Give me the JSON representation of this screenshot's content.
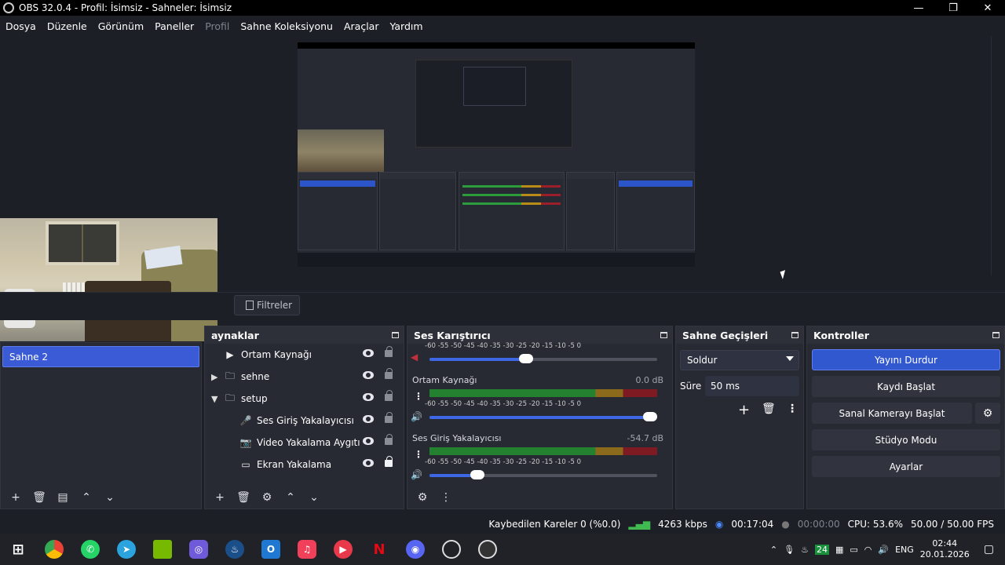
{
  "window": {
    "title": "OBS 32.0.4 - Profil: İsimsiz - Sahneler: İsimsiz",
    "minimize": "—",
    "restore": "❐",
    "close": "✕"
  },
  "menu": [
    "Dosya",
    "Düzenle",
    "Görünüm",
    "Paneller",
    "Profil",
    "Sahne Koleksiyonu",
    "Araçlar",
    "Yardım"
  ],
  "filter_button": "Filtreler",
  "scenes": {
    "title_visible": "",
    "items": [
      "Sahne 2"
    ]
  },
  "sources": {
    "title": "aynaklar",
    "items": [
      {
        "label": "Ortam Kaynağı",
        "icon": "play-icon",
        "indent": 0,
        "expand": "",
        "locked": false
      },
      {
        "label": "sehne",
        "icon": "folder-icon",
        "indent": 0,
        "expand": "▶",
        "locked": false
      },
      {
        "label": "setup",
        "icon": "folder-icon",
        "indent": 0,
        "expand": "▼",
        "locked": false
      },
      {
        "label": "Ses Giriş Yakalayıcısı",
        "icon": "microphone-icon",
        "indent": 1,
        "expand": "",
        "locked": false
      },
      {
        "label": "Video Yakalama Aygıtı",
        "icon": "camera-icon",
        "indent": 1,
        "expand": "",
        "locked": false
      },
      {
        "label": "Ekran Yakalama",
        "icon": "monitor-icon",
        "indent": 1,
        "expand": "",
        "locked": true
      }
    ]
  },
  "mixer": {
    "title": "Ses Karıştırıcı",
    "ticks": "-60  -55  -50  -45  -40  -35  -30  -25  -20  -15  -10  -5  0",
    "channels": [
      {
        "name": "",
        "db": "",
        "volume": 0.4
      },
      {
        "name": "Ortam Kaynağı",
        "db": "0.0 dB",
        "volume": 1.0
      },
      {
        "name": "Ses Giriş Yakalayıcısı",
        "db": "-54.7 dB",
        "volume": 0.2
      }
    ]
  },
  "transitions": {
    "title": "Sahne Geçişleri",
    "selected": "Soldur",
    "duration_label": "Süre",
    "duration_value": "50 ms"
  },
  "controls": {
    "title": "Kontroller",
    "buttons": [
      "Yayını Durdur",
      "Kaydı Başlat",
      "Sanal Kamerayı Başlat",
      "Stüdyo Modu",
      "Ayarlar"
    ]
  },
  "status": {
    "dropped": "Kaybedilen Kareler 0 (%0.0)",
    "bitrate": "4263 kbps",
    "stream_time": "00:17:04",
    "rec_time": "00:00:00",
    "cpu": "CPU: 53.6%",
    "fps": "50.00 / 50.00 FPS"
  },
  "tray": {
    "lang": "ENG",
    "time": "02:44",
    "date": "20.01.2026"
  },
  "colors": {
    "accent": "#3258d0",
    "dock": "#272a33",
    "background": "#1d1f26"
  }
}
